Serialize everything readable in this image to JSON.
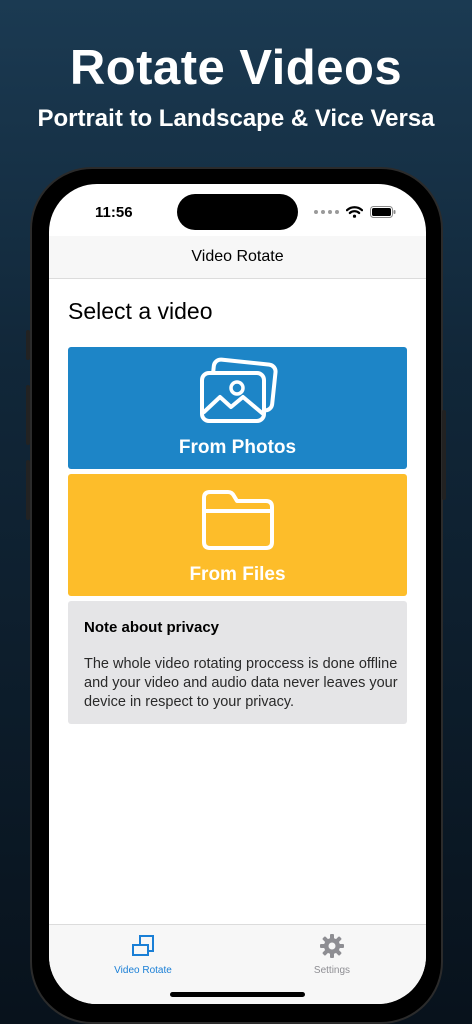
{
  "hero": {
    "title": "Rotate Videos",
    "subtitle": "Portrait to Landscape & Vice Versa"
  },
  "status_bar": {
    "time": "11:56",
    "icons": [
      "signal-dots-icon",
      "wifi-icon",
      "battery-icon"
    ]
  },
  "nav": {
    "title": "Video Rotate"
  },
  "content": {
    "title": "Select a video",
    "photos_option": {
      "label": "From Photos",
      "icon": "photos-icon",
      "color": "#1d85c7"
    },
    "files_option": {
      "label": "From Files",
      "icon": "folder-icon",
      "color": "#fdbd2a"
    },
    "privacy": {
      "title": "Note about privacy",
      "body": "The whole video rotating proccess is done offline and your video and audio data never leaves your device in respect to your privacy."
    }
  },
  "tab_bar": {
    "tabs": [
      {
        "label": "Video Rotate",
        "icon": "rotate-icon",
        "active": true
      },
      {
        "label": "Settings",
        "icon": "gear-icon",
        "active": false
      }
    ],
    "active_color": "#1a7fd6",
    "inactive_color": "#8e8e93"
  }
}
